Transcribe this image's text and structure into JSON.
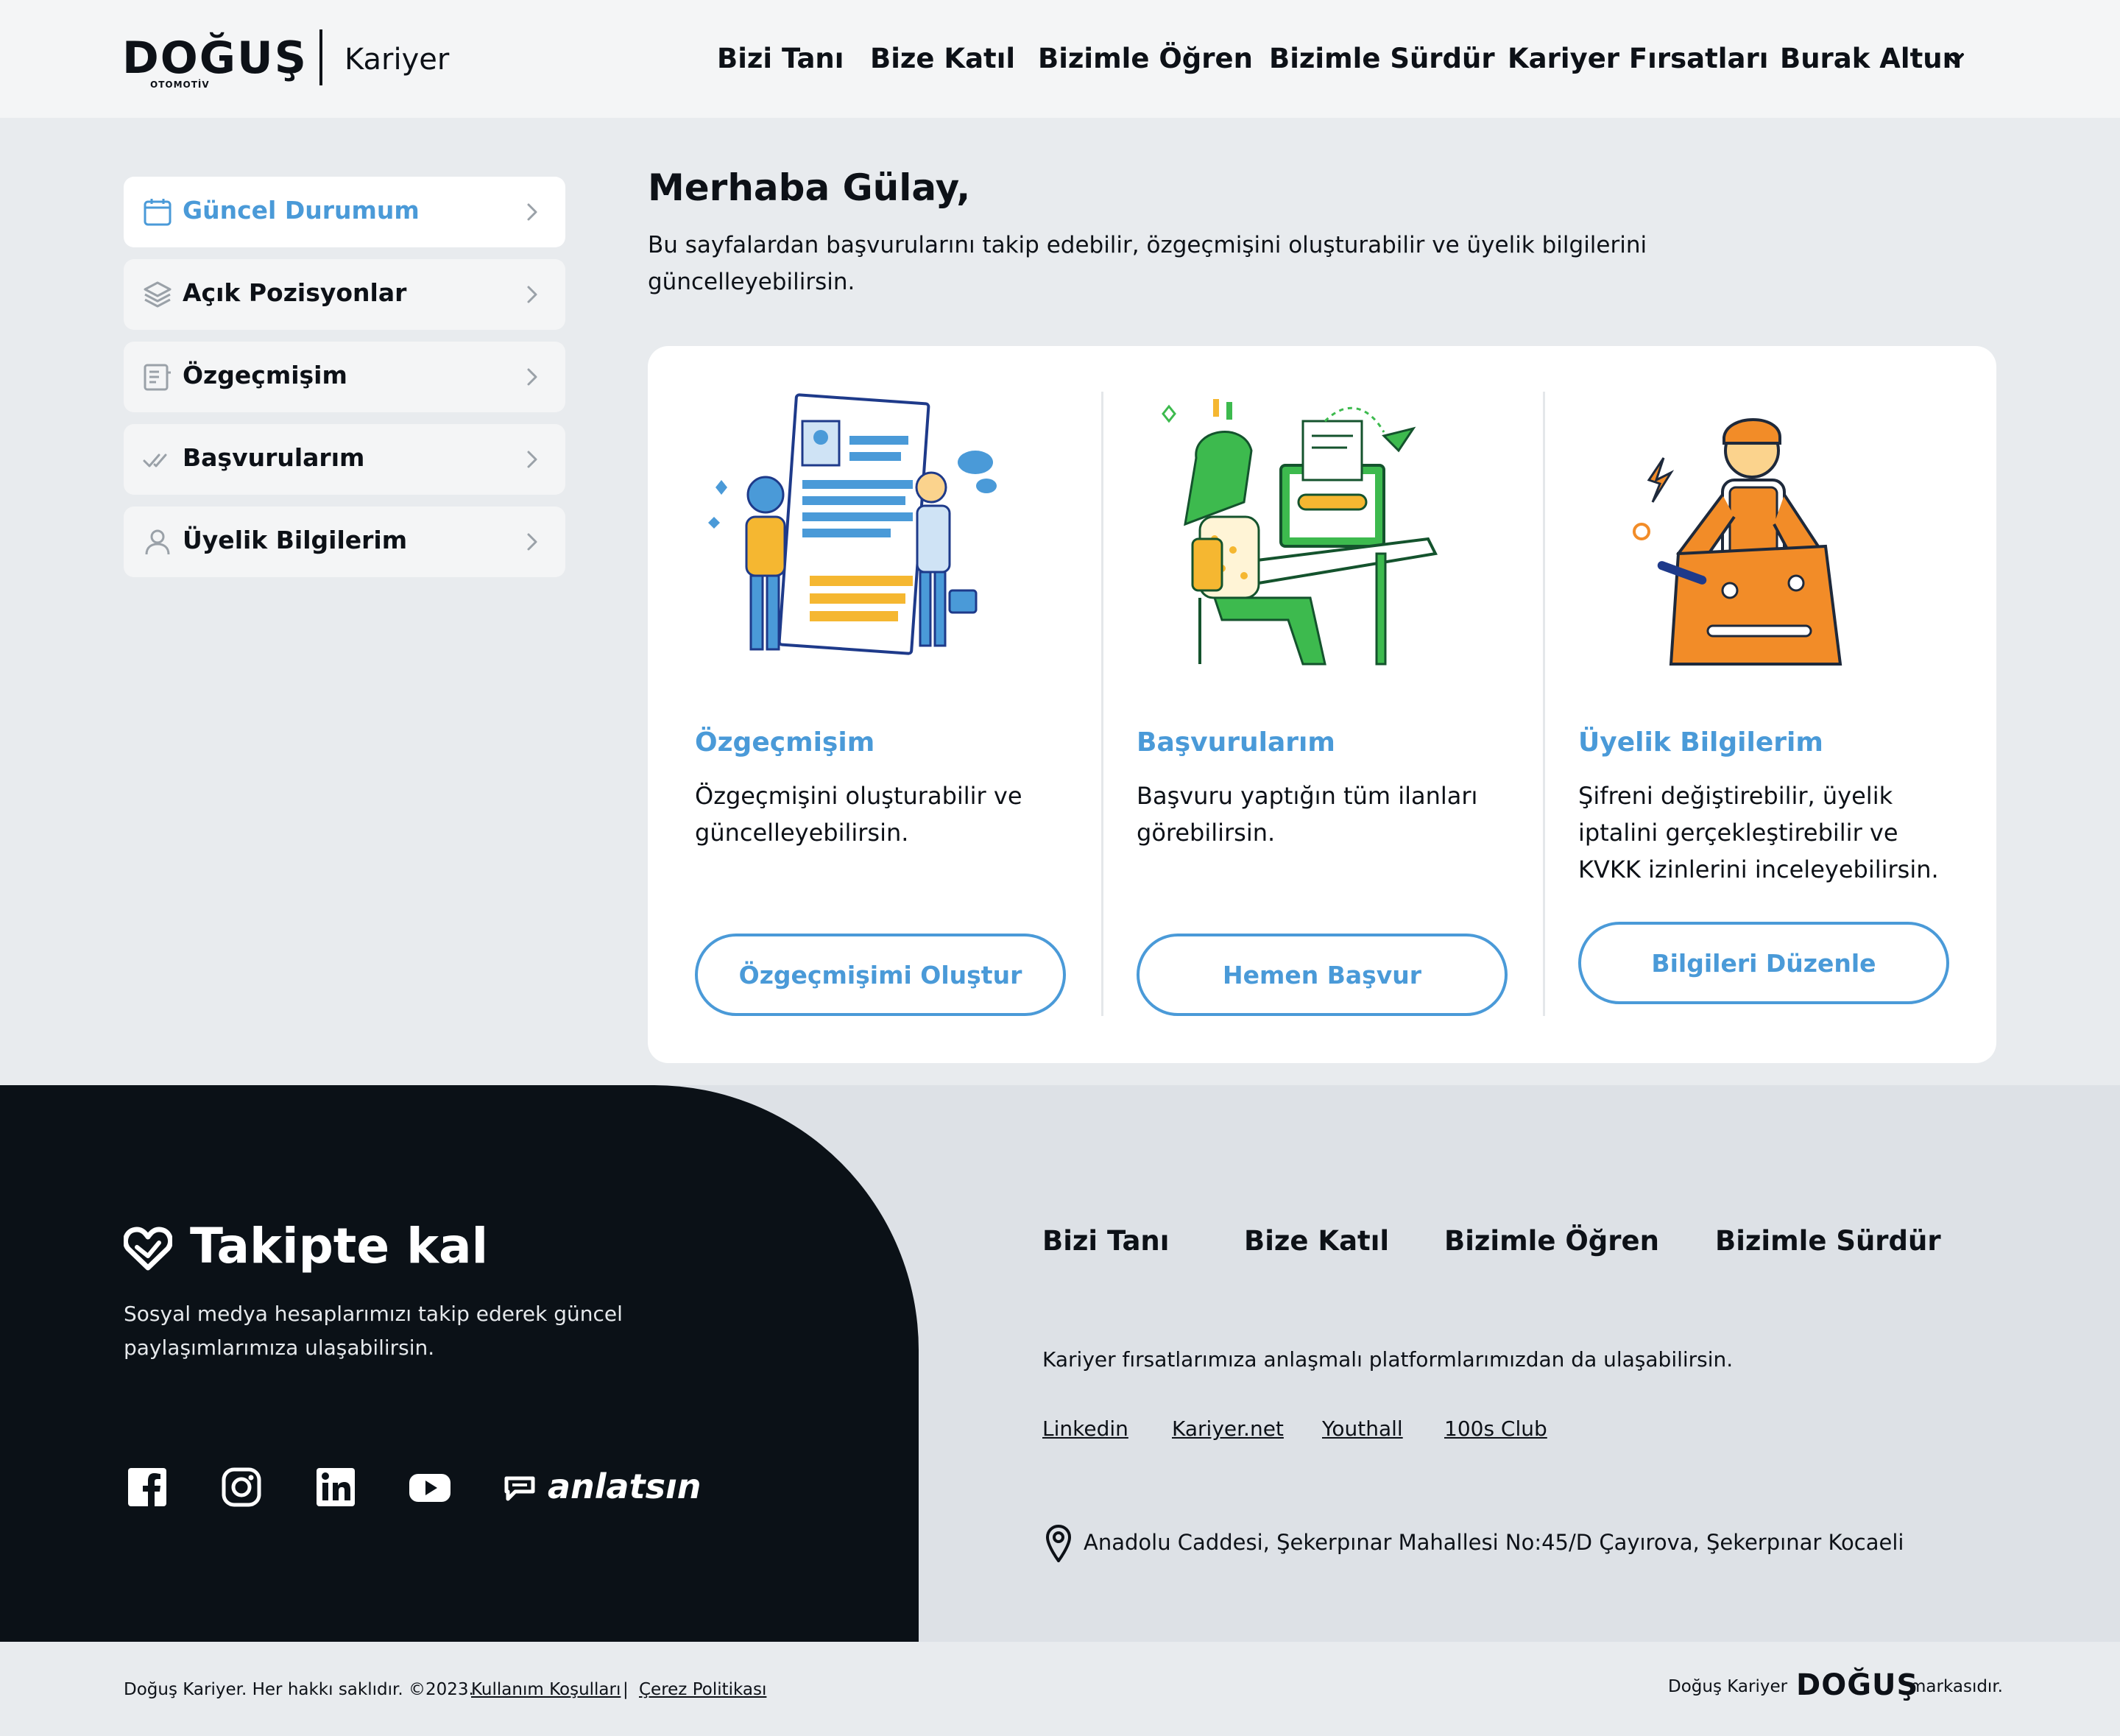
{
  "header": {
    "logo_text": "DOĞUŞ",
    "logo_sub": "OTOMOTİV",
    "section": "Kariyer",
    "nav": [
      "Bizi Tanı",
      "Bize Katıl",
      "Bizimle Öğren",
      "Bizimle Sürdür",
      "Kariyer Fırsatları"
    ],
    "user": "Burak Altun"
  },
  "sidebar": {
    "items": [
      {
        "label": "Güncel Durumum",
        "icon": "calendar-icon",
        "active": true
      },
      {
        "label": "Açık Pozisyonlar",
        "icon": "layers-icon",
        "active": false
      },
      {
        "label": "Özgeçmişim",
        "icon": "document-icon",
        "active": false
      },
      {
        "label": "Başvurularım",
        "icon": "double-check-icon",
        "active": false
      },
      {
        "label": "Üyelik Bilgilerim",
        "icon": "user-icon",
        "active": false
      }
    ]
  },
  "main": {
    "greeting": "Merhaba Gülay,",
    "intro": "Bu sayfalardan başvurularını takip edebilir, özgeçmişini oluşturabilir ve üyelik bilgilerini güncelleyebilirsin.",
    "cards": [
      {
        "title": "Özgeçmişim",
        "text": "Özgeçmişini oluşturabilir ve güncelleyebilirsin.",
        "button": "Özgeçmişimi Oluştur"
      },
      {
        "title": "Başvurularım",
        "text": "Başvuru yaptığın tüm ilanları görebilirsin.",
        "button": "Hemen Başvur"
      },
      {
        "title": "Üyelik Bilgilerim",
        "text": "Şifreni değiştirebilir, üyelik iptalini gerçekleştirebilir ve KVKK izinlerini inceleyebilirsin.",
        "button": "Bilgileri Düzenle"
      }
    ]
  },
  "footer": {
    "follow_title": "Takipte kal",
    "follow_text": "Sosyal medya hesaplarımızı takip ederek güncel paylaşımlarımıza ulaşabilirsin.",
    "social": [
      "facebook-icon",
      "instagram-icon",
      "linkedin-icon",
      "youtube-icon",
      "anlatsin-logo"
    ],
    "anlatsin_text": "anlatsın",
    "nav": [
      "Bizi Tanı",
      "Bize Katıl",
      "Bizimle Öğren",
      "Bizimle Sürdür"
    ],
    "platforms_text": "Kariyer fırsatlarımıza anlaşmalı platformlarımızdan da ulaşabilirsin.",
    "platforms": [
      "Linkedin",
      "Kariyer.net",
      "Youthall",
      "100s Club"
    ],
    "address": "Anadolu Caddesi, Şekerpınar Mahallesi No:45/D Çayırova, Şekerpınar Kocaeli"
  },
  "bottom": {
    "copyright": "Doğuş Kariyer. Her hakkı saklıdır. ©2023.",
    "terms": "Kullanım Koşulları",
    "separator": "|",
    "cookies": "Çerez Politikası",
    "brand_prefix": "Doğuş Kariyer",
    "brand_logo": "DOĞUŞ",
    "brand_suffix": "markasıdır."
  },
  "colors": {
    "accent": "#4a9ad8",
    "dark": "#0b1117",
    "page_bg": "#e8ebee"
  }
}
